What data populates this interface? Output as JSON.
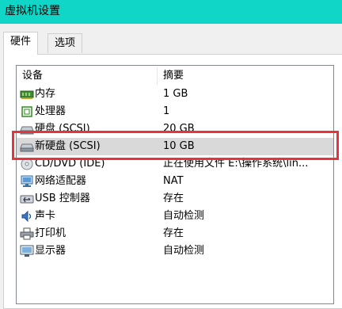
{
  "window": {
    "title": "虚拟机设置"
  },
  "tabs": [
    {
      "label": "硬件",
      "active": true
    },
    {
      "label": "选项",
      "active": false
    }
  ],
  "table": {
    "columns": [
      "设备",
      "摘要"
    ],
    "rows": [
      {
        "icon": "memory-icon",
        "device": "内存",
        "summary": "1 GB"
      },
      {
        "icon": "processor-icon",
        "device": "处理器",
        "summary": "1"
      },
      {
        "icon": "hard-disk-icon",
        "device": "硬盘 (SCSI)",
        "summary": "20 GB"
      },
      {
        "icon": "hard-disk-icon",
        "device": "新硬盘 (SCSI)",
        "summary": "10 GB",
        "selected": true
      },
      {
        "icon": "cd-dvd-icon",
        "device": "CD/DVD (IDE)",
        "summary": "正在使用文件 E:\\操作系统\\lin..."
      },
      {
        "icon": "network-adapter-icon",
        "device": "网络适配器",
        "summary": "NAT"
      },
      {
        "icon": "usb-icon",
        "device": "USB 控制器",
        "summary": "存在"
      },
      {
        "icon": "sound-card-icon",
        "device": "声卡",
        "summary": "自动检测"
      },
      {
        "icon": "printer-icon",
        "device": "打印机",
        "summary": "存在"
      },
      {
        "icon": "display-icon",
        "device": "显示器",
        "summary": "自动检测"
      }
    ]
  },
  "colors": {
    "titlebar": "#0fd6c6",
    "selection": "#d9d9d9",
    "highlight_box": "#e8333b"
  }
}
